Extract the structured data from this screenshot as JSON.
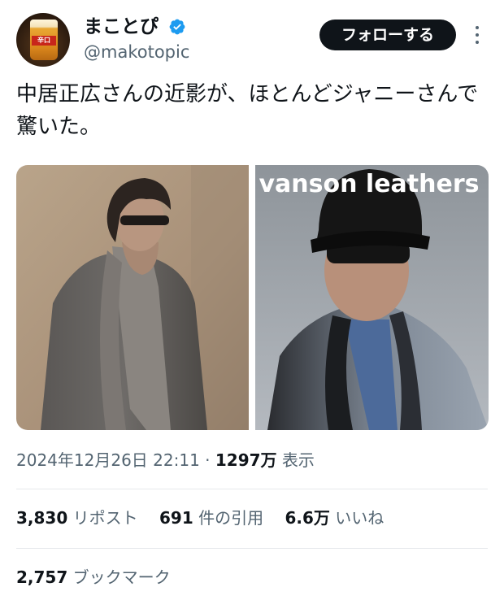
{
  "author": {
    "display_name": "まことぴ",
    "handle": "@makotopic",
    "avatar_label": "辛口"
  },
  "follow_label": "フォローする",
  "tweet_text": "中居正広さんの近影が、ほとんどジャニーさんで驚いた。",
  "cap_text": "vanson leathers",
  "meta": {
    "date": "2024年12月26日 22:11",
    "separator": "·",
    "views": "1297万",
    "views_label": "表示"
  },
  "stats": {
    "reposts": "3,830",
    "reposts_label": "リポスト",
    "quotes": "691",
    "quotes_label": "件の引用",
    "likes": "6.6万",
    "likes_label": "いいね",
    "bookmarks": "2,757",
    "bookmarks_label": "ブックマーク"
  },
  "colors": {
    "verified": "#1d9bf0",
    "follow_bg": "#0f1419",
    "secondary_text": "#536471"
  },
  "icons": [
    "verified-badge-icon",
    "more-options-icon"
  ]
}
